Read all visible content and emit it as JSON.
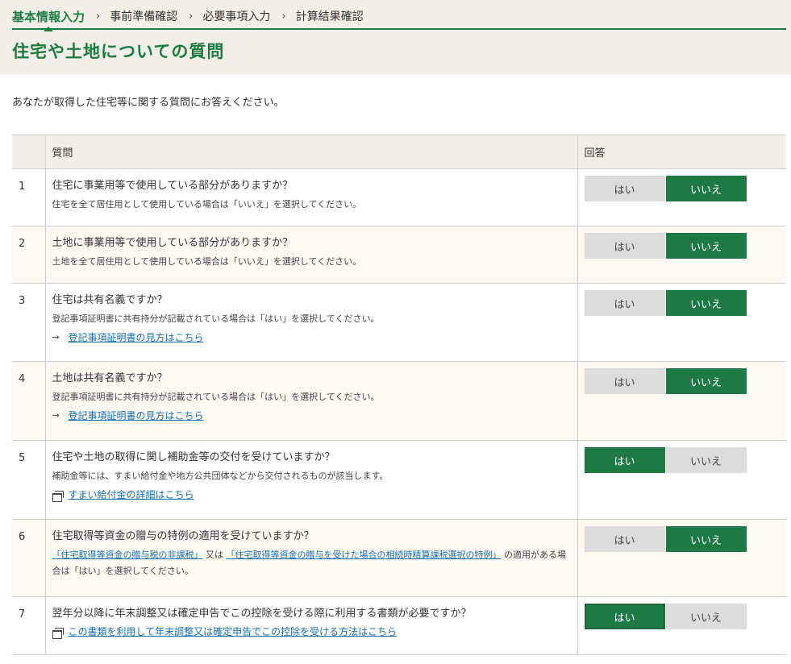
{
  "steps": [
    {
      "label": "基本情報入力"
    },
    {
      "label": "事前準備確認"
    },
    {
      "label": "必要事項入力"
    },
    {
      "label": "計算結果確認"
    }
  ],
  "step_separator": "›",
  "title": "住宅や土地についての質問",
  "intro": "あなたが取得した住宅等に関する質問にお答えください。",
  "table": {
    "col_question": "質問",
    "col_answer": "回答"
  },
  "answer_labels": {
    "yes": "はい",
    "no": "いいえ"
  },
  "colors": {
    "accent": "#1d7a44",
    "header_bg": "#f1efe6",
    "link": "#1a6fb0"
  },
  "questions": [
    {
      "num": "1",
      "text": "住宅に事業用等で使用している部分がありますか？",
      "note": "住宅を全て居住用として使用している場合は「いいえ」を選択してください。",
      "selected": "no"
    },
    {
      "num": "2",
      "text": "土地に事業用等で使用している部分がありますか？",
      "note": "土地を全て居住用として使用している場合は「いいえ」を選択してください。",
      "selected": "no"
    },
    {
      "num": "3",
      "text": "住宅は共有名義ですか？",
      "note": "登記事項証明書に共有持分が記載されている場合は「はい」を選択してください。",
      "link_text": "登記事項証明書の見方はこちら",
      "link_icon": "arrow-right-icon",
      "selected": "no"
    },
    {
      "num": "4",
      "text": "土地は共有名義ですか？",
      "note": "登記事項証明書に共有持分が記載されている場合は「はい」を選択してください。",
      "link_text": "登記事項証明書の見方はこちら",
      "link_icon": "arrow-right-icon",
      "selected": "no"
    },
    {
      "num": "5",
      "text": "住宅や土地の取得に関し補助金等の交付を受けていますか？",
      "note": "補助金等には、すまい給付金や地方公共団体などから交付されるものが該当します。",
      "link_text": "すまい給付金の詳細はこちら",
      "link_icon": "new-window-icon",
      "selected": "yes"
    },
    {
      "num": "6",
      "text": "住宅取得等資金の贈与の特例の適用を受けていますか？",
      "note_link1": "「住宅取得等資金の贈与税の非課税」",
      "note_mid": "又は",
      "note_link2": "「住宅取得等資金の贈与を受けた場合の相続時精算課税選択の特例」",
      "note_tail": "の適用がある場合は「はい」を選択してください。",
      "selected": "no"
    },
    {
      "num": "7",
      "text": "翌年分以降に年末調整又は確定申告でこの控除を受ける際に利用する書類が必要ですか？",
      "link_text": "この書類を利用して年末調整又は確定申告でこの控除を受ける方法はこちら",
      "link_icon": "new-window-icon",
      "selected": "yes"
    }
  ]
}
